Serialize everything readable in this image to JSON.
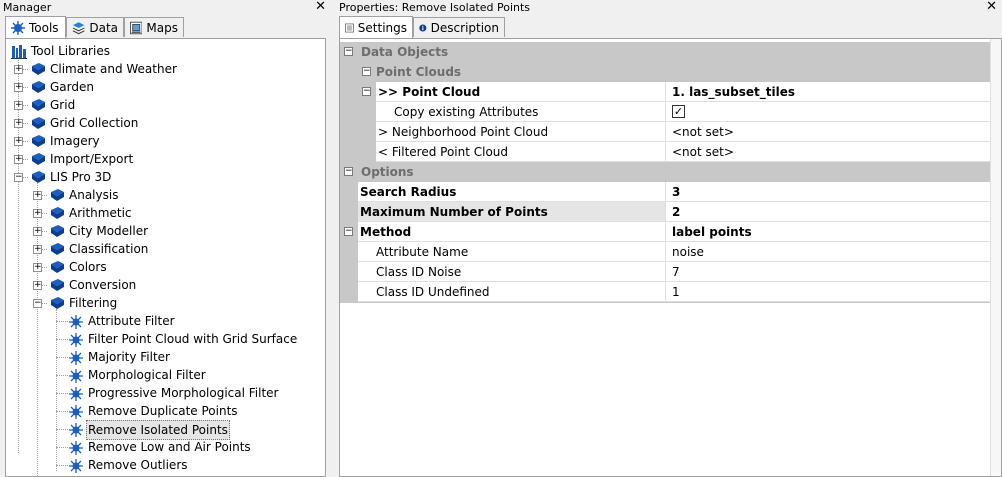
{
  "manager": {
    "title": "Manager",
    "close": "✕",
    "tabs": [
      {
        "label": "Tools",
        "icon": "tools-icon"
      },
      {
        "label": "Data",
        "icon": "data-stack-icon"
      },
      {
        "label": "Maps",
        "icon": "maps-icon"
      }
    ],
    "tree": {
      "root": "Tool Libraries",
      "level1": [
        "Climate and Weather",
        "Garden",
        "Grid",
        "Grid Collection",
        "Imagery",
        "Import/Export"
      ],
      "lis": "LIS Pro 3D",
      "level2": [
        "Analysis",
        "Arithmetic",
        "City Modeller",
        "Classification",
        "Colors",
        "Conversion"
      ],
      "filtering": "Filtering",
      "tools": [
        "Attribute Filter",
        "Filter Point Cloud with Grid Surface",
        "Majority Filter",
        "Morphological Filter",
        "Progressive Morphological Filter",
        "Remove Duplicate Points",
        "Remove Isolated Points",
        "Remove Low and Air Points",
        "Remove Outliers"
      ]
    }
  },
  "properties": {
    "title": "Properties: Remove Isolated Points",
    "close": "✕",
    "tabs": [
      {
        "label": "Settings",
        "icon": "settings-grid-icon"
      },
      {
        "label": "Description",
        "icon": "info-icon"
      }
    ],
    "rows": {
      "data_objects": "Data Objects",
      "point_clouds": "Point Clouds",
      "point_cloud": {
        "name": ">> Point Cloud",
        "value": "1. las_subset_tiles"
      },
      "copy_attr": {
        "name": "Copy existing Attributes",
        "value": "✓"
      },
      "neighborhood": {
        "name": "> Neighborhood Point Cloud",
        "value": "<not set>"
      },
      "filtered": {
        "name": "< Filtered Point Cloud",
        "value": "<not set>"
      },
      "options": "Options",
      "search_radius": {
        "name": "Search Radius",
        "value": "3"
      },
      "max_points": {
        "name": "Maximum Number of Points",
        "value": "2"
      },
      "method": {
        "name": "Method",
        "value": "label points"
      },
      "attr_name": {
        "name": "Attribute Name",
        "value": "noise"
      },
      "class_noise": {
        "name": "Class ID Noise",
        "value": "7"
      },
      "class_undef": {
        "name": "Class ID Undefined",
        "value": "1"
      }
    }
  },
  "expand_minus": "−",
  "expand_plus": "+",
  "colors": {
    "accent": "#1a5fbf",
    "category": "#c8c8c8",
    "selection": "#e5e5e5"
  }
}
